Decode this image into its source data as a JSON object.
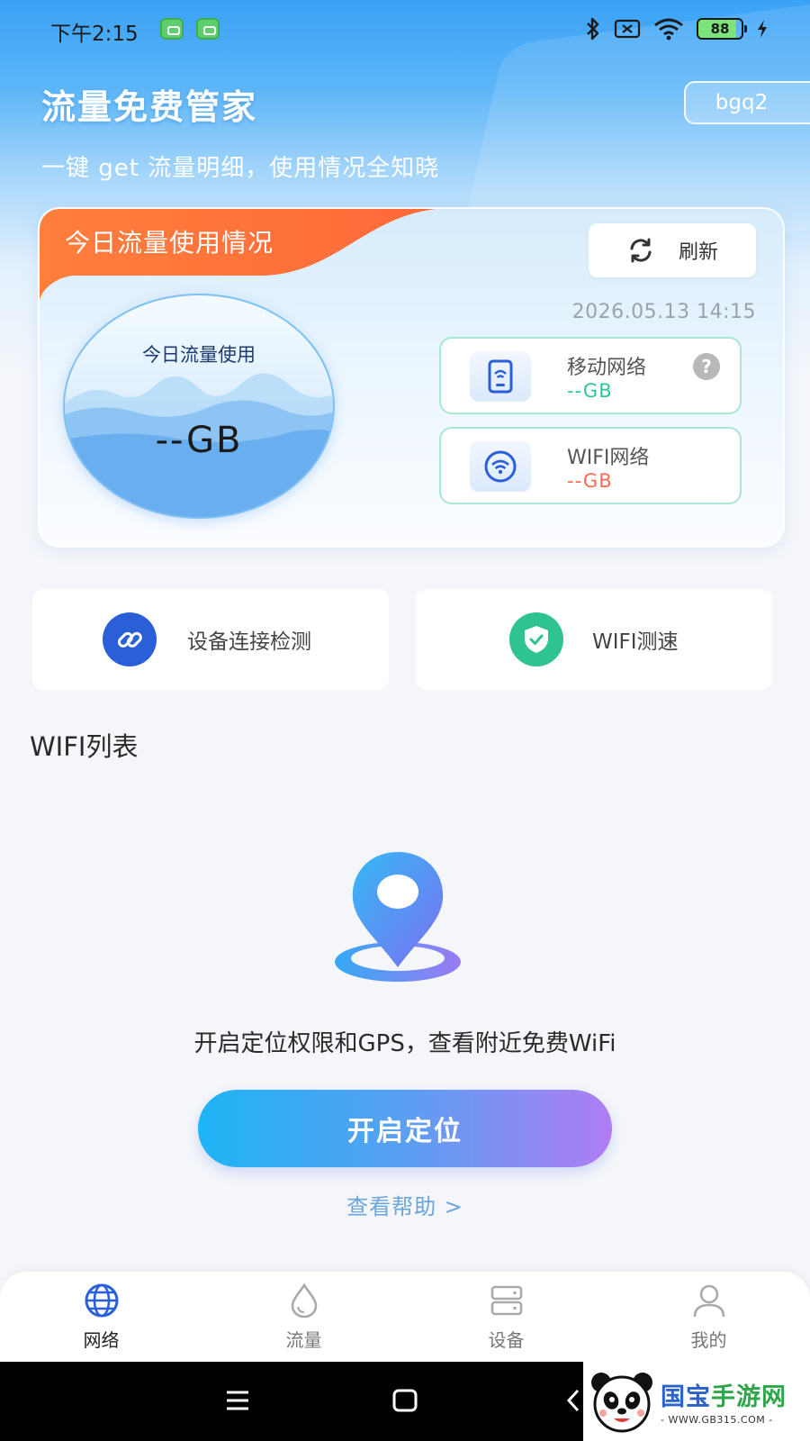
{
  "status_bar": {
    "time": "下午2:15",
    "battery": "88"
  },
  "header": {
    "title": "流量免费管家",
    "user_badge": "bgq2",
    "subtitle": "一键 get 流量明细，使用情况全知晓"
  },
  "usage_card": {
    "tab_title": "今日流量使用情况",
    "refresh_label": "刷新",
    "timestamp": "2026.05.13 14:15",
    "circle_label": "今日流量使用",
    "circle_value": "--GB",
    "mobile": {
      "name": "移动网络",
      "value": "--GB",
      "help": "?"
    },
    "wifi": {
      "name": "WIFI网络",
      "value": "--GB"
    }
  },
  "tools": {
    "device_check": "设备连接检测",
    "wifi_speed": "WIFI测速"
  },
  "wifi_section": {
    "title": "WIFI列表",
    "message": "开启定位权限和GPS，查看附近免费WiFi",
    "enable_button": "开启定位",
    "help_link": "查看帮助 >"
  },
  "tabbar": {
    "items": [
      {
        "label": "网络",
        "icon": "globe-icon",
        "active": true
      },
      {
        "label": "流量",
        "icon": "droplet-icon",
        "active": false
      },
      {
        "label": "设备",
        "icon": "server-icon",
        "active": false
      },
      {
        "label": "我的",
        "icon": "user-icon",
        "active": false
      }
    ]
  },
  "watermark": {
    "brand_part1": "国宝",
    "brand_part2": "手游网",
    "url": "- WWW.GB315.COM -"
  },
  "colors": {
    "accent_orange": "#ff6a3a",
    "accent_green": "#2ec49a",
    "accent_red": "#ff6a55",
    "button_gradient_start": "#1eb4f5",
    "button_gradient_end": "#b07cf3"
  }
}
